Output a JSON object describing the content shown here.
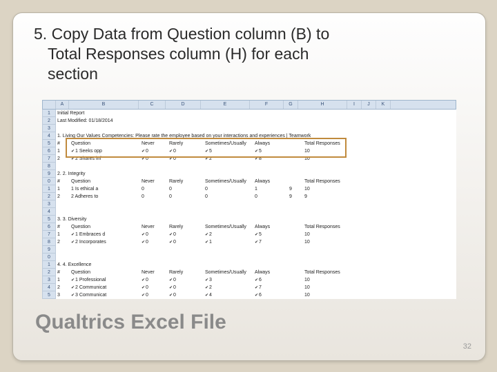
{
  "step": {
    "number": "5.",
    "line1": "Copy Data from Question column (B) to",
    "line2": "Total Responses column (H) for each",
    "line3": "section"
  },
  "footer_title": "Qualtrics Excel File",
  "page_number": "32",
  "excel": {
    "cols": [
      "",
      "A",
      "B",
      "C",
      "D",
      "E",
      "F",
      "G",
      "H",
      "I",
      "J",
      "K"
    ],
    "r1a": "Initial Report",
    "r2a": "Last Modified: 01/18/2014",
    "sec1_title": "1.  Living Our Values Competencies: Please rate the employee based on your interactions and experiences | Teamwork",
    "hdrA": "#",
    "hdrB": "Question",
    "hdrC": "Never",
    "hdrD": "Rarely",
    "hdrE": "Sometimes/Usually",
    "hdrF": "Always",
    "hdrH": "Total Responses",
    "s1r1": {
      "n": "1",
      "q": "1 Seeks opp",
      "c": "0",
      "d": "0",
      "e": "5",
      "f": "5",
      "h": "10"
    },
    "s1r2": {
      "n": "2",
      "q": "2 Shares inf",
      "c": "0",
      "d": "0",
      "e": "2",
      "f": "8",
      "h": "10"
    },
    "sec2_title": "2.  2. Integrity",
    "s2r1": {
      "n": "1",
      "q": "1 Is ethical a",
      "c": "0",
      "d": "0",
      "e": "0",
      "f": "1",
      "g": "9",
      "h": "10"
    },
    "s2r2": {
      "n": "2",
      "q": "2 Adheres to",
      "c": "0",
      "d": "0",
      "e": "0",
      "f": "0",
      "g": "9",
      "h": "9"
    },
    "sec3_title": "3.  3. Diversity",
    "s3r1": {
      "n": "1",
      "q": "1 Embraces d",
      "c": "0",
      "d": "0",
      "e": "2",
      "f": "5",
      "h": "10"
    },
    "s3r2": {
      "n": "2",
      "q": "2 Incorporates",
      "c": "0",
      "d": "0",
      "e": "1",
      "f": "7",
      "h": "10"
    },
    "sec4_title": "4.  4. Excellence",
    "s4r1": {
      "n": "1",
      "q": "1 Professional",
      "c": "0",
      "d": "0",
      "e": "3",
      "f": "6",
      "h": "10"
    },
    "s4r2": {
      "n": "2",
      "q": "2 Communicat",
      "c": "0",
      "d": "0",
      "e": "2",
      "f": "7",
      "h": "10"
    },
    "s4r3": {
      "n": "3",
      "q": "3 Communicat",
      "c": "0",
      "d": "0",
      "e": "4",
      "f": "6",
      "h": "10"
    }
  }
}
